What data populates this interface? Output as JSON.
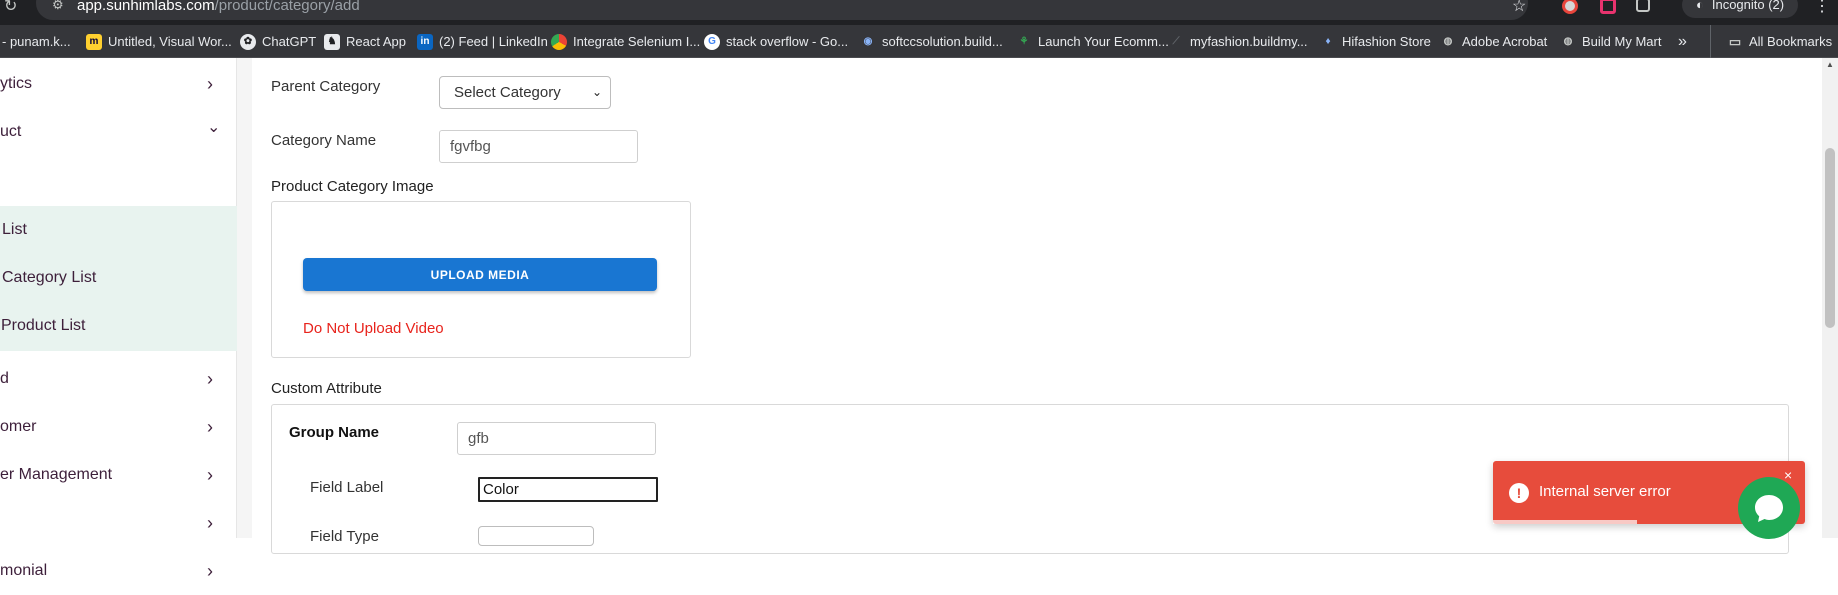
{
  "browser": {
    "url_host": "app.sunhimlabs.com",
    "url_path": "/product/category/add",
    "incognito_label": "Incognito (2)",
    "bookmarks": [
      {
        "label": "- punam.k...",
        "icon": ""
      },
      {
        "label": "Untitled, Visual Wor...",
        "icon": "miro"
      },
      {
        "label": "ChatGPT",
        "icon": "openai"
      },
      {
        "label": "React App",
        "icon": "react"
      },
      {
        "label": "(2) Feed | LinkedIn",
        "icon": "linkedin"
      },
      {
        "label": "Integrate Selenium I...",
        "icon": "chrome"
      },
      {
        "label": "stack overflow - Go...",
        "icon": "google"
      },
      {
        "label": "softccsolution.build...",
        "icon": "globe"
      },
      {
        "label": "Launch Your Ecomm...",
        "icon": "shop"
      },
      {
        "label": "myfashion.buildmy...",
        "icon": "fashion"
      },
      {
        "label": "Hifashion Store",
        "icon": "store"
      },
      {
        "label": "Adobe Acrobat",
        "icon": "globe"
      },
      {
        "label": "Build My Mart",
        "icon": "globe"
      }
    ],
    "overflow_label": "»",
    "all_bookmarks_label": "All Bookmarks"
  },
  "sidebar": {
    "items": [
      {
        "label": "ytics",
        "chevron": "›"
      },
      {
        "label": "uct",
        "chevron": "⌄"
      },
      {
        "label": "List",
        "chevron": ""
      },
      {
        "label": "Category List",
        "chevron": ""
      },
      {
        "label": "Product List",
        "chevron": ""
      },
      {
        "label": "d",
        "chevron": "›"
      },
      {
        "label": "omer",
        "chevron": "›"
      },
      {
        "label": "er Management",
        "chevron": "›"
      },
      {
        "label": "",
        "chevron": "›"
      },
      {
        "label": "monial",
        "chevron": "›"
      }
    ]
  },
  "form": {
    "parent_category_label": "Parent Category",
    "parent_category_value": "Select Category",
    "category_name_label": "Category Name",
    "category_name_value": "fgvfbg",
    "image_section_title": "Product Category Image",
    "upload_button": "UPLOAD MEDIA",
    "upload_warning": "Do Not Upload Video",
    "custom_attr_title": "Custom Attribute",
    "group_name_label": "Group Name",
    "group_name_value": "gfb",
    "field_label_label": "Field Label",
    "field_label_value": "Color",
    "field_type_label": "Field Type"
  },
  "toast": {
    "message": "Internal server error",
    "close": "×",
    "progress": 0.46
  },
  "colors": {
    "accent_button": "#1976d2",
    "error": "#e74c3c",
    "chat": "#1fa855",
    "sidebar_active_bg": "#e8f3ef"
  }
}
